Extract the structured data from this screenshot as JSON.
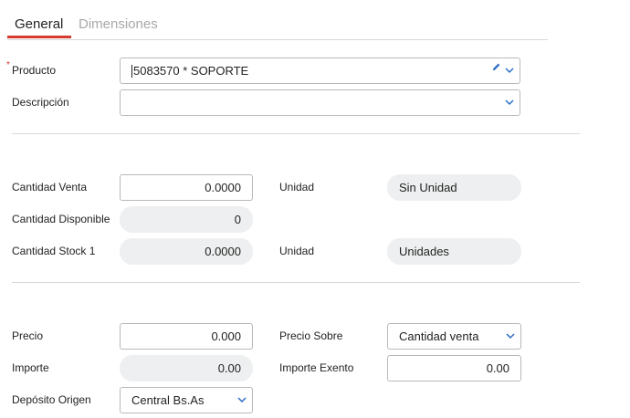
{
  "tabs": {
    "general": "General",
    "dimensiones": "Dimensiones"
  },
  "producto": {
    "label": "Producto",
    "required_mark": "*",
    "value": "5083570 * SOPORTE"
  },
  "descripcion": {
    "label": "Descripción",
    "value": ""
  },
  "cantidad_venta": {
    "label": "Cantidad Venta",
    "value": "0.0000"
  },
  "unidad_1": {
    "label": "Unidad",
    "value": "Sin Unidad"
  },
  "cantidad_disponible": {
    "label": "Cantidad Disponible",
    "value": "0"
  },
  "cantidad_stock": {
    "label": "Cantidad Stock 1",
    "value": "0.0000"
  },
  "unidad_2": {
    "label": "Unidad",
    "value": "Unidades"
  },
  "precio": {
    "label": "Precio",
    "value": "0.000"
  },
  "precio_sobre": {
    "label": "Precio Sobre",
    "value": "Cantidad venta"
  },
  "importe": {
    "label": "Importe",
    "value": "0.00"
  },
  "importe_exento": {
    "label": "Importe Exento",
    "value": "0.00"
  },
  "deposito_origen": {
    "label": "Depósito Origen",
    "value": "Central Bs.As"
  },
  "colors": {
    "accent": "#d63a2f",
    "link": "#2b6cc4",
    "readonly_bg": "#eeeff0",
    "border": "#b9b9b9"
  }
}
